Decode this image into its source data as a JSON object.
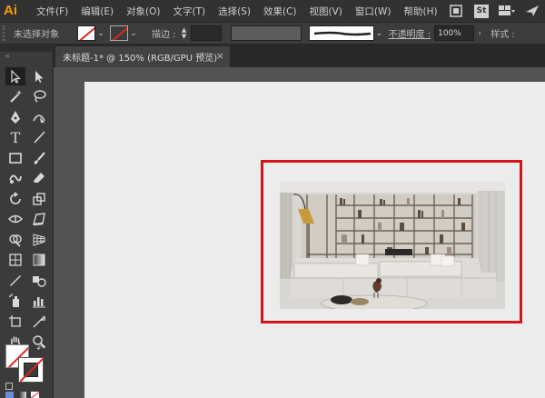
{
  "app": {
    "logo": "Ai"
  },
  "menu": [
    "文件(F)",
    "编辑(E)",
    "对象(O)",
    "文字(T)",
    "选择(S)",
    "效果(C)",
    "视图(V)",
    "窗口(W)",
    "帮助(H)"
  ],
  "menu_right": {
    "st_label": "St",
    "icons": [
      "bridge-icon",
      "stock-icon",
      "workspace-switcher-icon",
      "send-icon"
    ]
  },
  "control_bar": {
    "selection_label": "未选择对象",
    "stroke_label": "描边 :",
    "opacity_label": "不透明度 :",
    "opacity_value": "100%",
    "style_label": "样式 :"
  },
  "document_tab": {
    "title": "未标题-1* @ 150% (RGB/GPU 预览)",
    "close": "×"
  },
  "colors": {
    "accent": "#ff9a00",
    "frame": "#d2141c",
    "artboard": "#ececec",
    "canvas": "#535353"
  },
  "tools": [
    "selection-tool",
    "direct-selection-tool",
    "magic-wand-tool",
    "lasso-tool",
    "pen-tool",
    "curvature-tool",
    "type-tool",
    "line-tool",
    "rectangle-tool",
    "paintbrush-tool",
    "shaper-tool",
    "eraser-tool",
    "rotate-tool",
    "scale-tool",
    "width-tool",
    "free-transform-tool",
    "shape-builder-tool",
    "perspective-grid-tool",
    "mesh-tool",
    "gradient-tool",
    "eyedropper-tool",
    "blend-tool",
    "symbol-sprayer-tool",
    "column-graph-tool",
    "artboard-tool",
    "slice-tool",
    "hand-tool",
    "zoom-tool"
  ],
  "canvas": {
    "image_name": "living-room-photo"
  }
}
